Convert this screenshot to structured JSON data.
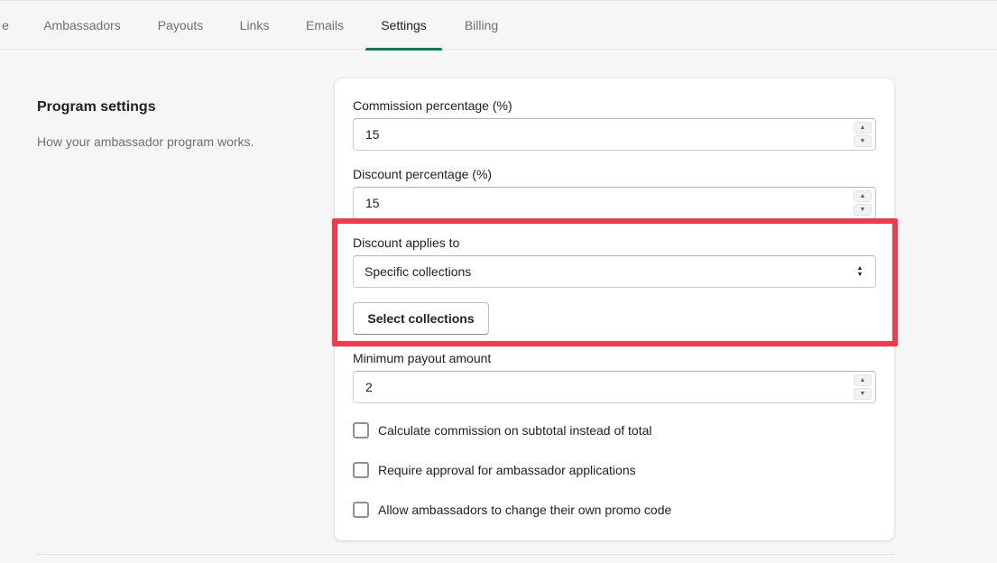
{
  "tabs": [
    {
      "label": "e"
    },
    {
      "label": "Ambassadors"
    },
    {
      "label": "Payouts"
    },
    {
      "label": "Links"
    },
    {
      "label": "Emails"
    },
    {
      "label": "Settings",
      "active": true
    },
    {
      "label": "Billing"
    }
  ],
  "section": {
    "title": "Program settings",
    "description": "How your ambassador program works."
  },
  "fields": {
    "commission": {
      "label": "Commission percentage (%)",
      "value": "15"
    },
    "discount": {
      "label": "Discount percentage (%)",
      "value": "15"
    },
    "applies_to": {
      "label": "Discount applies to",
      "value": "Specific collections"
    },
    "select_collections_label": "Select collections",
    "min_payout": {
      "label": "Minimum payout amount",
      "value": "2"
    }
  },
  "checkboxes": [
    {
      "label": "Calculate commission on subtotal instead of total",
      "checked": false
    },
    {
      "label": "Require approval for ambassador applications",
      "checked": false
    },
    {
      "label": "Allow ambassadors to change their own promo code",
      "checked": false
    }
  ],
  "colors": {
    "accent": "#008060",
    "highlight": "#f23a4d"
  },
  "icons": {
    "stepper_up": "caret-up-icon",
    "stepper_down": "caret-down-icon",
    "select": "select-chevrons-icon"
  }
}
